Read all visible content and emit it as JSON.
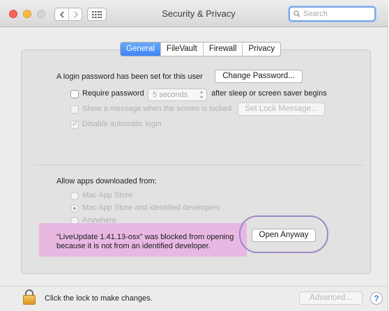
{
  "window": {
    "title": "Security & Privacy"
  },
  "search": {
    "placeholder": "Search"
  },
  "tabs": [
    {
      "label": "General",
      "active": true
    },
    {
      "label": "FileVault",
      "active": false
    },
    {
      "label": "Firewall",
      "active": false
    },
    {
      "label": "Privacy",
      "active": false
    }
  ],
  "general": {
    "login_password_text": "A login password has been set for this user",
    "change_password_label": "Change Password...",
    "require_password": {
      "label": "Require password",
      "interval": "5 seconds",
      "suffix": "after sleep or screen saver begins",
      "checked": false
    },
    "show_message": {
      "label": "Show a message when the screen is locked",
      "checked": false,
      "enabled": false
    },
    "set_lock_message_label": "Set Lock Message...",
    "disable_auto_login": {
      "label": "Disable automatic login",
      "checked": true,
      "enabled": false
    }
  },
  "apps": {
    "heading": "Allow apps downloaded from:",
    "options": [
      {
        "label": "Mac App Store",
        "selected": false
      },
      {
        "label": "Mac App Store and identified developers",
        "selected": true
      },
      {
        "label": "Anywhere",
        "selected": false
      }
    ],
    "blocked_line1": "“LiveUpdate 1.41.13-osx” was blocked from opening",
    "blocked_line2": "because it is not from an identified developer.",
    "open_anyway_label": "Open Anyway"
  },
  "footer": {
    "lock_text": "Click the lock to make changes.",
    "advanced_label": "Advanced...",
    "help_label": "?"
  },
  "colors": {
    "tab_active": "#4a8ff6",
    "highlight": "#e8b8e3",
    "annotation_oval": "#9d86c9"
  }
}
